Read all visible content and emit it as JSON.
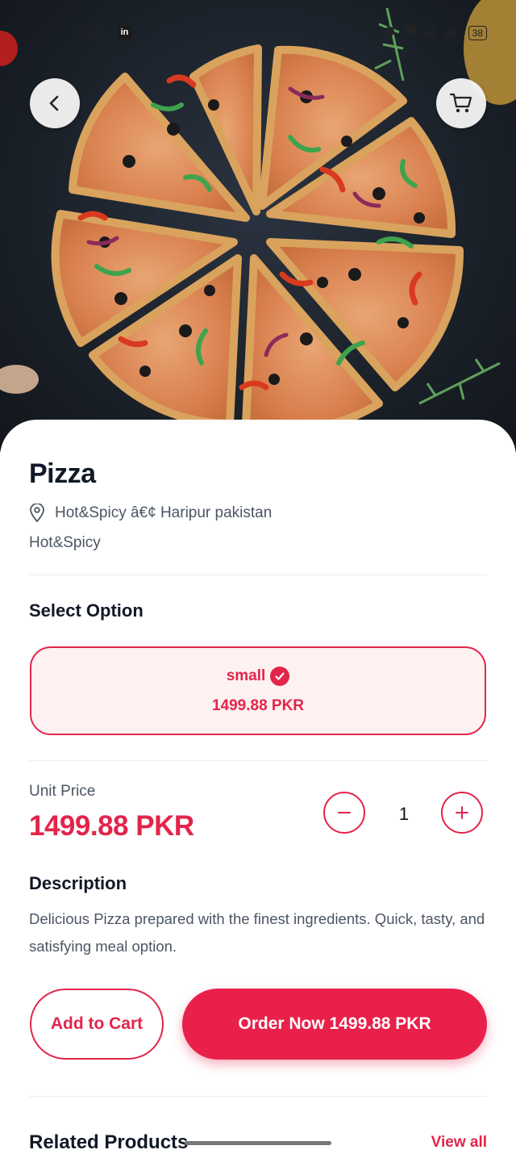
{
  "status_bar": {
    "time": "2:49",
    "app_icon": "in",
    "battery": "38"
  },
  "hero": {
    "image": "pizza-photo"
  },
  "nav": {
    "back_icon": "chevron-left-icon",
    "cart_icon": "cart-icon"
  },
  "product": {
    "name": "Pizza",
    "location": "Hot&Spicy â€¢ Haripur pakistan",
    "category": "Hot&Spicy"
  },
  "options": {
    "heading": "Select Option",
    "selected": {
      "name": "small",
      "price": "1499.88 PKR"
    }
  },
  "pricing": {
    "unit_label": "Unit Price",
    "unit_price": "1499.88 PKR",
    "quantity": "1"
  },
  "description": {
    "heading": "Description",
    "text": "Delicious Pizza prepared with the finest ingredients. Quick, tasty, and satisfying meal option."
  },
  "actions": {
    "add_to_cart": "Add to Cart",
    "order_now": "Order Now 1499.88 PKR"
  },
  "related": {
    "heading": "Related Products",
    "view_all": "View all"
  },
  "colors": {
    "accent": "#e2254b",
    "accent_bg": "#fdf1f1",
    "text": "#111827",
    "muted": "#4b5563"
  }
}
